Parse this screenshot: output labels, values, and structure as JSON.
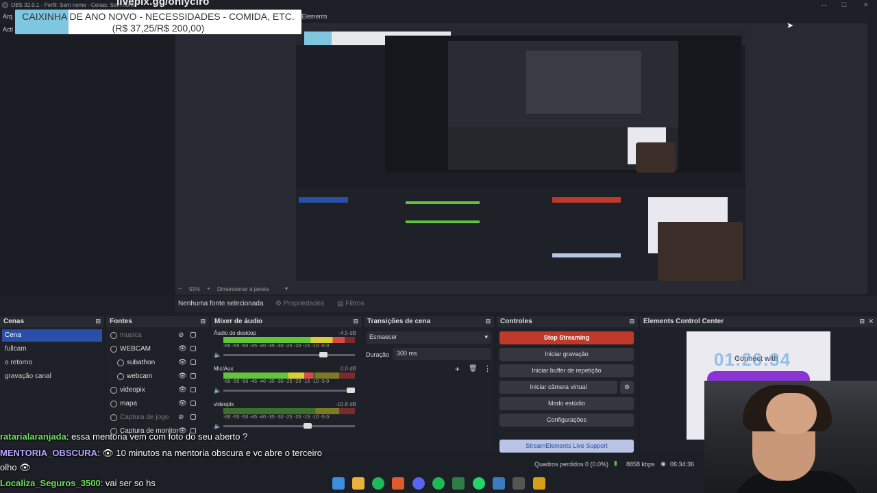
{
  "window": {
    "title": "OBS 32.0.1 - Perfil: Sem nome - Cenas: Sem nome"
  },
  "menu": {
    "item_first": "Arq",
    "item_elements": "Elements",
    "item_acti": "Acti"
  },
  "overlay": {
    "livepix": "livepix.gg/onlyciro",
    "donation_title": "CAIXINHA DE ANO NOVO - NECESSIDADES - COMIDA, ETC.",
    "donation_amount": "(R$ 37,25/R$ 200,00)",
    "donation_progress": 0.186
  },
  "zoom": {
    "value": "51%",
    "label": "Dimensionar à janela"
  },
  "sourcebar": {
    "no_source": "Nenhuma fonte selecionada",
    "properties": "Propriedades",
    "filters": "Filtros"
  },
  "scenes": {
    "title": "Cenas",
    "items": [
      "Cena",
      "fullcam",
      "o retorno",
      "gravação canal"
    ],
    "selected": 0
  },
  "sources": {
    "title": "Fontes",
    "items": [
      {
        "name": "musica",
        "icon": "music-icon",
        "visible": false
      },
      {
        "name": "WEBCAM",
        "icon": "folder-icon",
        "visible": true
      },
      {
        "name": "subathon",
        "icon": "globe-icon",
        "visible": true
      },
      {
        "name": "webcam",
        "icon": "camera-icon",
        "visible": true
      },
      {
        "name": "videopix",
        "icon": "globe-icon",
        "visible": true
      },
      {
        "name": "mapa",
        "icon": "image-icon",
        "visible": true
      },
      {
        "name": "Captura de jogo",
        "icon": "gamepad-icon",
        "visible": false
      },
      {
        "name": "Captura de monitor",
        "icon": "monitor-icon",
        "visible": true
      }
    ]
  },
  "mixer": {
    "title": "Mixer de áudio",
    "ticks": "-60 -55 -50 -45 -40 -35 -30 -25 -20 -15 -10 -5 0",
    "channels": [
      {
        "name": "Áudio do desktop",
        "db": "-4.5 dB",
        "level": 0.92,
        "volume": 0.78
      },
      {
        "name": "Mic/Aux",
        "db": "0.0 dB",
        "level": 0.68,
        "volume": 1.0
      },
      {
        "name": "videopix",
        "db": "-10.8 dB",
        "level": 0.0,
        "volume": 0.65
      }
    ]
  },
  "transitions": {
    "title": "Transições de cena",
    "selected": "Esmaecer",
    "duration_label": "Duração",
    "duration_value": "300 ms"
  },
  "controls": {
    "title": "Controles",
    "stop_streaming": "Stop Streaming",
    "start_recording": "Iniciar gravação",
    "replay_buffer": "Iniciar buffer de repetição",
    "virtual_cam": "Iniciar câmera virtual",
    "studio_mode": "Modo estúdio",
    "settings": "Configurações",
    "se_support": "StreamElements Live Support"
  },
  "ecc": {
    "title": "Elements Control Center",
    "timer": "01:26:34",
    "connect": "Connect with"
  },
  "status": {
    "dropped": "Quadros perdidos 0 (0.0%)",
    "bitrate": "8858 kbps",
    "time": "06:34:36"
  },
  "chat": [
    {
      "user": "ratarialaranjada",
      "msg": ": essa mentoria vem com foto do seu aberto ?"
    },
    {
      "user": "MENTORIA_OBSCURA",
      "msg": ": 👁 10 minutos na mentoria obscura e vc abre o terceiro"
    },
    {
      "user": "",
      "msg": "olho 👁"
    },
    {
      "user": "Localiza_Seguros_3500",
      "msg": ": vai ser so hs"
    }
  ],
  "colors": {
    "accent": "#2b4ea9",
    "stop": "#c0392b",
    "user_green": "#6ce35a",
    "user_purple": "#b7a6ff"
  }
}
